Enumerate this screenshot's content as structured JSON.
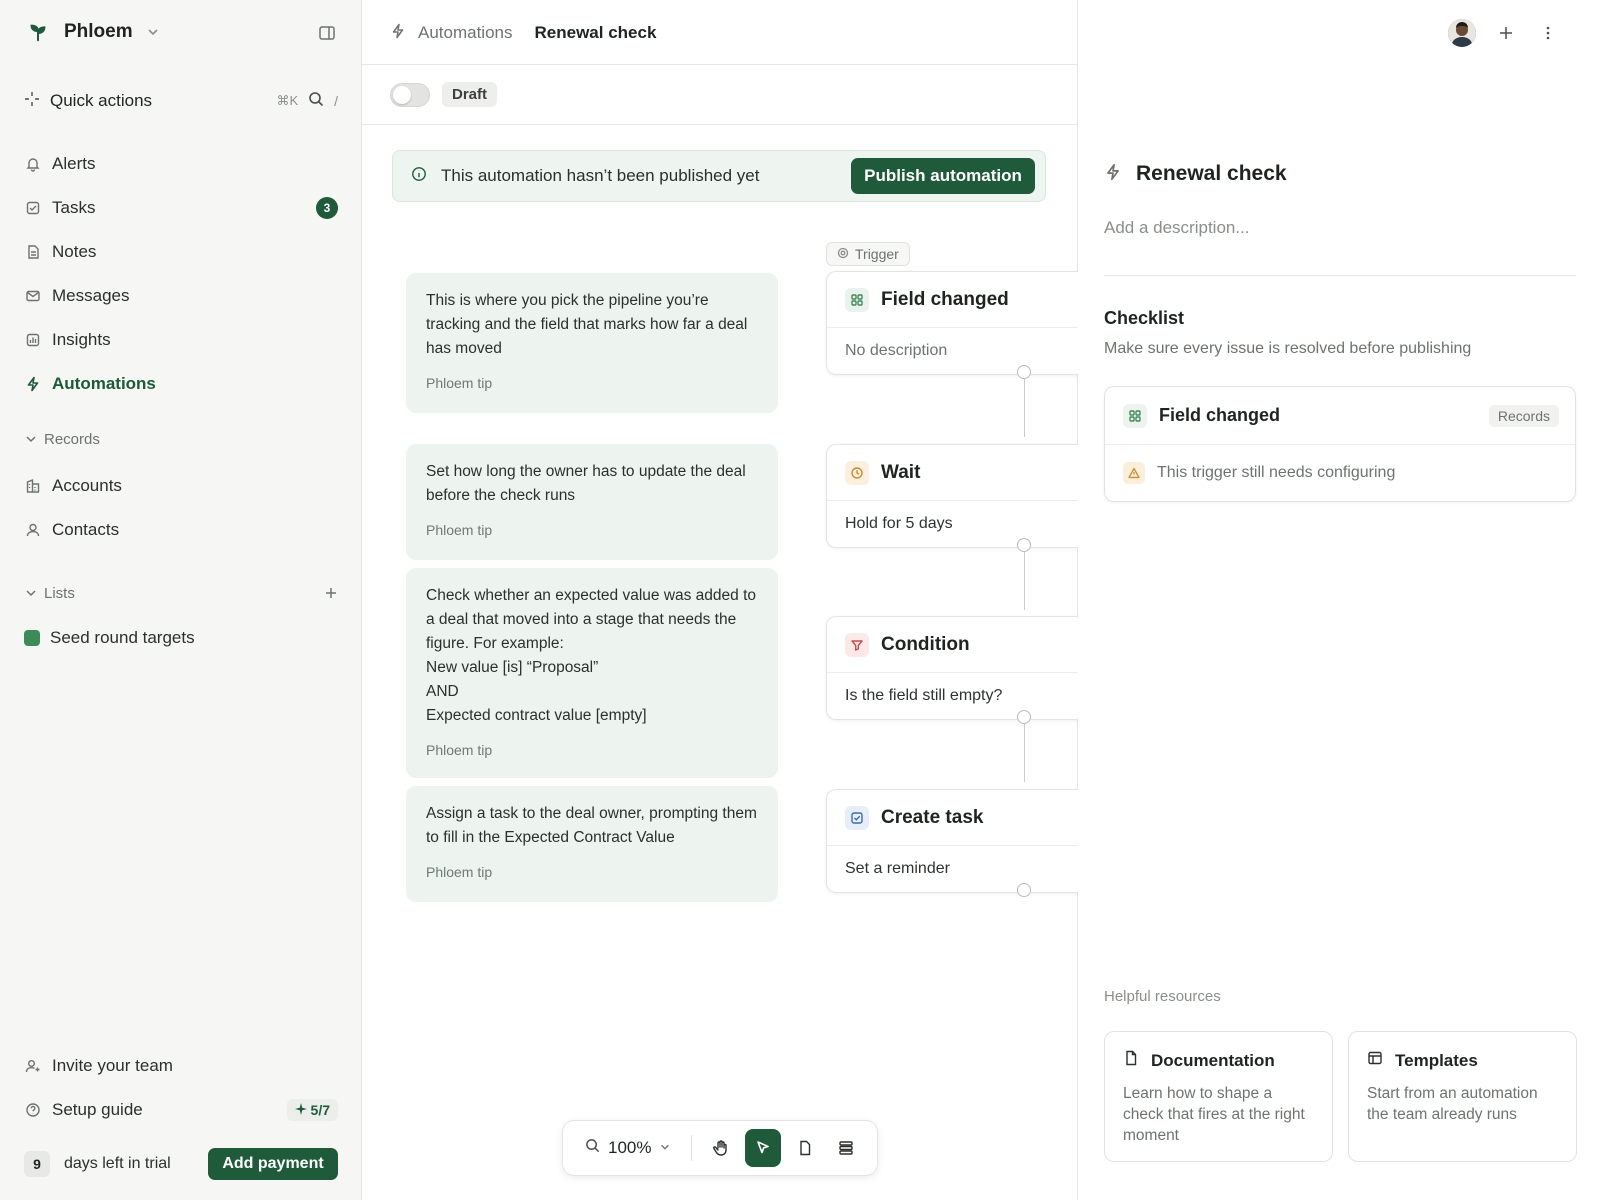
{
  "sidebar": {
    "workspace": "Phloem",
    "quick_actions": {
      "label": "Quick actions",
      "shortcut": "⌘K",
      "slash": "/"
    },
    "nav": [
      {
        "label": "Alerts",
        "icon": "bell-icon"
      },
      {
        "label": "Tasks",
        "icon": "checkbox-icon",
        "badge": "3"
      },
      {
        "label": "Notes",
        "icon": "note-icon"
      },
      {
        "label": "Messages",
        "icon": "mail-icon"
      },
      {
        "label": "Insights",
        "icon": "chart-icon"
      },
      {
        "label": "Automations",
        "icon": "bolt-icon",
        "active": true
      }
    ],
    "records_section": "Records",
    "records": [
      {
        "label": "Accounts",
        "icon": "building-icon"
      },
      {
        "label": "Contacts",
        "icon": "person-icon"
      }
    ],
    "lists_section": "Lists",
    "lists": [
      {
        "label": "Seed round targets",
        "color": "#3f8a5a"
      }
    ],
    "invite": "Invite your team",
    "setup_guide": {
      "label": "Setup guide",
      "progress": "5/7"
    },
    "trial": {
      "days": "9",
      "text": "days left in trial",
      "button": "Add payment"
    }
  },
  "header": {
    "breadcrumb_parent": "Automations",
    "breadcrumb_current": "Renewal check",
    "status_pill": "Draft"
  },
  "banner": {
    "text": "This automation hasn’t been published yet",
    "button": "Publish automation"
  },
  "tips": [
    {
      "body": "This is where you pick the pipeline you’re tracking and the field that marks how far a deal has moved",
      "footer": "Phloem tip"
    },
    {
      "body": "Set how long the owner has to update the deal before the check runs",
      "footer": "Phloem tip"
    },
    {
      "body": "Check whether an expected value was added to a deal that moved into a stage that needs the figure. For example:\nNew value [is] “Proposal”\nAND\nExpected contract value [empty]",
      "footer": "Phloem tip"
    },
    {
      "body": "Assign a task to the deal owner, prompting them to fill in the Expected Contract Value",
      "footer": "Phloem tip"
    }
  ],
  "trigger_tag": "Trigger",
  "nodes": [
    {
      "title": "Field changed",
      "desc": "No description",
      "icon": "grid-icon",
      "accent": "#3f8a5a"
    },
    {
      "title": "Wait",
      "desc": "Hold for 5 days",
      "icon": "clock-icon",
      "accent": "#d28a2c"
    },
    {
      "title": "Condition",
      "desc": "Is the field still empty?",
      "icon": "filter-icon",
      "accent": "#c0504d"
    },
    {
      "title": "Create task",
      "desc": "Set a reminder",
      "icon": "task-icon",
      "accent": "#3a6ab0"
    }
  ],
  "toolbar": {
    "zoom": "100%"
  },
  "panel": {
    "title": "Renewal check",
    "description_placeholder": "Add a description...",
    "checklist_title": "Checklist",
    "checklist_sub": "Make sure every issue is resolved before publishing",
    "check_item": {
      "title": "Field changed",
      "tag": "Records",
      "warning": "This trigger still needs configuring"
    },
    "resources_label": "Helpful resources",
    "resources": [
      {
        "title": "Documentation",
        "body": "Learn how to shape a check that fires at the right moment",
        "icon": "doc-icon"
      },
      {
        "title": "Templates",
        "body": "Start from an automation the team already runs",
        "icon": "template-icon"
      }
    ]
  },
  "colors": {
    "brand": "#1f5b3a",
    "tip_bg": "#edf3ef"
  }
}
